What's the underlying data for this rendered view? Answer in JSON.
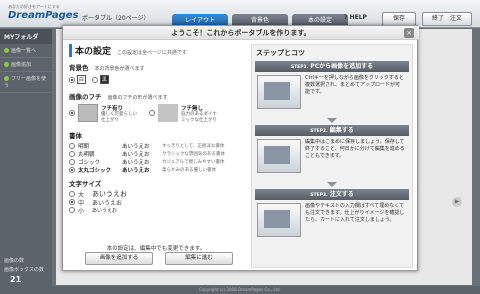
{
  "header": {
    "logo_tagline": "あなたの好きをアートにする",
    "logo_name": "DreamPages",
    "product": "ポータブル（20ページ）",
    "tabs": [
      {
        "label": "レイアウト",
        "active": true
      },
      {
        "label": "背景色",
        "active": false
      },
      {
        "label": "本の設定",
        "active": false
      }
    ],
    "help": "? HELP",
    "save": "保存",
    "finish": "終了　注文"
  },
  "sidebar": {
    "title": "MYフォルダ",
    "items": [
      "画像一覧へ",
      "画像追加",
      "フリー画像を使う"
    ],
    "stat1_label": "画像の数",
    "stat2_label": "画像ボックスの数",
    "stat2_value": "21"
  },
  "footer": "Copyright (c) 2008 DreamPages Co., Ltd.",
  "modal": {
    "title": "ようこそ！これからポータブルを作ります。",
    "close": "×",
    "settings": {
      "heading": "本の設定",
      "heading_note": "この設定は全ページに共通です",
      "bg": {
        "label": "背景色",
        "note": "本の背景色が選べます",
        "options": [
          {
            "chip": "白",
            "selected": true
          },
          {
            "chip": "黒",
            "selected": false
          }
        ]
      },
      "frame": {
        "label": "画像のフチ",
        "note": "画像のフチの形が選べます",
        "options": [
          {
            "title": "フチ有り",
            "desc": "優しく可愛らしい仕上がり",
            "selected": true
          },
          {
            "title": "フチ無し",
            "desc": "迫力のあるダイナミックな仕上がり",
            "selected": false
          }
        ]
      },
      "font": {
        "label": "書体",
        "options": [
          {
            "name": "明朝",
            "sample": "あいうえお",
            "desc": "すっきりとして、正統派な書体",
            "selected": false
          },
          {
            "name": "丸明朝",
            "sample": "あいうえお",
            "desc": "クラシックな雰囲気のある書体",
            "selected": false
          },
          {
            "name": "ゴシック",
            "sample": "あいうえお",
            "desc": "カジュアルで親しみやすい書体",
            "selected": false
          },
          {
            "name": "太丸ゴシック",
            "sample": "あいうえお",
            "desc": "柔らかみのある優しい書体",
            "selected": true
          }
        ]
      },
      "size": {
        "label": "文字サイズ",
        "options": [
          {
            "name": "大",
            "sample": "あいうえお",
            "selected": false
          },
          {
            "name": "中",
            "sample": "あいうえお",
            "selected": true
          },
          {
            "name": "小",
            "sample": "あいうえお",
            "selected": false
          }
        ]
      },
      "bottom_note": "本の設定は、編集中でも変更できます。",
      "btn_add": "画像を追加する",
      "btn_edit": "編集に進む"
    },
    "tips": {
      "title": "ステップとコツ",
      "steps": [
        {
          "no": "STEP1.",
          "title": "PCから画像を追加する",
          "text": "Ctrlキーを押しながら画像をクリックすると複数選択され、まとめてアップロードが可能です。"
        },
        {
          "no": "STEP2.",
          "title": "編集する",
          "text": "編集中はこまめに保存しましょう。保存して終了すること、何日かに分けて編集を進めることもできます。"
        },
        {
          "no": "STEP3.",
          "title": "注文する",
          "text": "画像やテキストの入力欄はすべて埋めなくても注文できます。仕上がりイメージを確認したら、カートに入れて注文しましょう。"
        }
      ]
    }
  }
}
